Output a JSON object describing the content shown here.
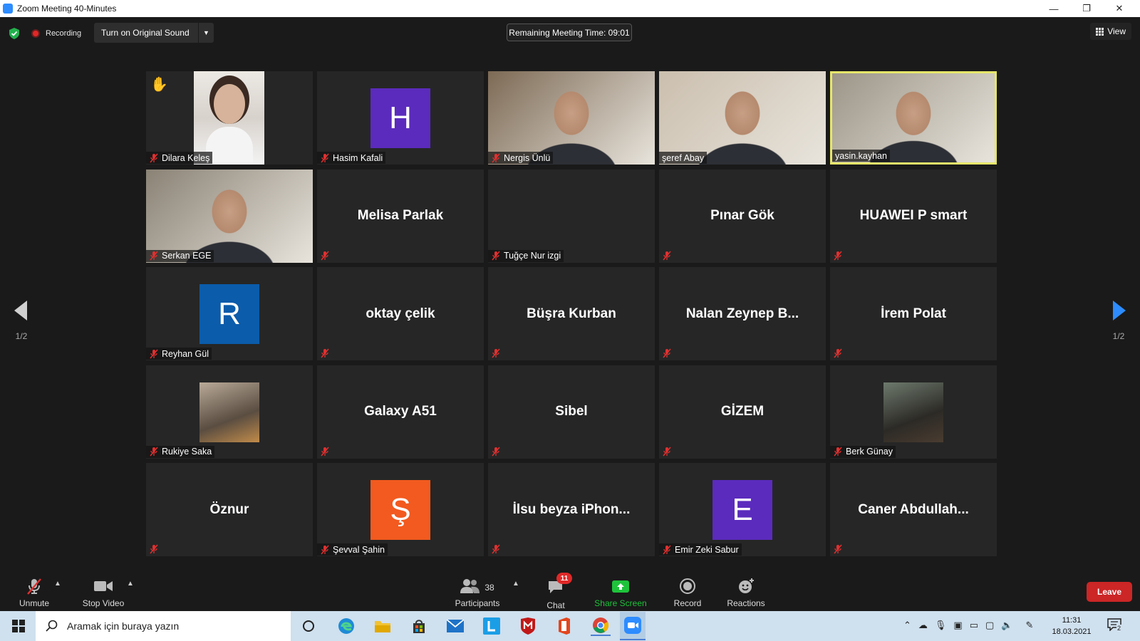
{
  "window": {
    "title": "Zoom Meeting 40-Minutes",
    "minimize": "—",
    "restore": "❐",
    "close": "✕"
  },
  "topbar": {
    "recording_label": "Recording",
    "original_sound_label": "Turn on Original Sound",
    "remaining_time_label": "Remaining Meeting Time: 09:01",
    "view_label": "View"
  },
  "gallery": {
    "page_indicator_left": "1/2",
    "page_indicator_right": "1/2",
    "tiles": [
      {
        "name": "Dilara Keleş",
        "raised_hand": true
      },
      {
        "name": "Hasim Kafali",
        "avatar_letter": "H",
        "avatar_color": "#5b2bbd"
      },
      {
        "name": "Nergis Ünlü"
      },
      {
        "name": "şeref Abay"
      },
      {
        "name": "yasin.kayhan",
        "active_speaker": true
      },
      {
        "name": "Serkan EGE"
      },
      {
        "center_name": "Melisa Parlak"
      },
      {
        "name": "Tuğçe Nur izgi"
      },
      {
        "center_name": "Pınar Gök"
      },
      {
        "center_name": "HUAWEI P smart"
      },
      {
        "name": "Reyhan Gül",
        "avatar_letter": "R",
        "avatar_color": "#0b5cab"
      },
      {
        "center_name": "oktay çelik"
      },
      {
        "center_name": "Büşra Kurban"
      },
      {
        "center_name": "Nalan  Zeynep  B..."
      },
      {
        "center_name": "İrem Polat"
      },
      {
        "name": "Rukiye Saka"
      },
      {
        "center_name": "Galaxy A51"
      },
      {
        "center_name": "Sibel"
      },
      {
        "center_name": "GİZEM"
      },
      {
        "name": "Berk Günay"
      },
      {
        "center_name": "Öznur"
      },
      {
        "name": "Şevval Şahin",
        "avatar_letter": "Ş",
        "avatar_color": "#f25a1f"
      },
      {
        "center_name": "İlsu  beyza  iPhon..."
      },
      {
        "name": "Emir Zeki Sabur",
        "avatar_letter": "E",
        "avatar_color": "#5b2bbd"
      },
      {
        "center_name": "Caner  Abdullah..."
      }
    ]
  },
  "toolbar": {
    "unmute_label": "Unmute",
    "stop_video_label": "Stop Video",
    "participants_label": "Participants",
    "participants_count": "38",
    "chat_label": "Chat",
    "chat_badge": "11",
    "share_screen_label": "Share Screen",
    "record_label": "Record",
    "reactions_label": "Reactions",
    "leave_label": "Leave"
  },
  "taskbar": {
    "search_placeholder": "Aramak için buraya yazın",
    "time": "11:31",
    "date": "18.03.2021",
    "notification_count": "2"
  },
  "colors": {
    "accent": "#2d8cff",
    "active_speaker_border": "#e6e66a",
    "leave": "#cc2626",
    "share_green": "#1ec33b",
    "muted_red": "#e03030"
  }
}
